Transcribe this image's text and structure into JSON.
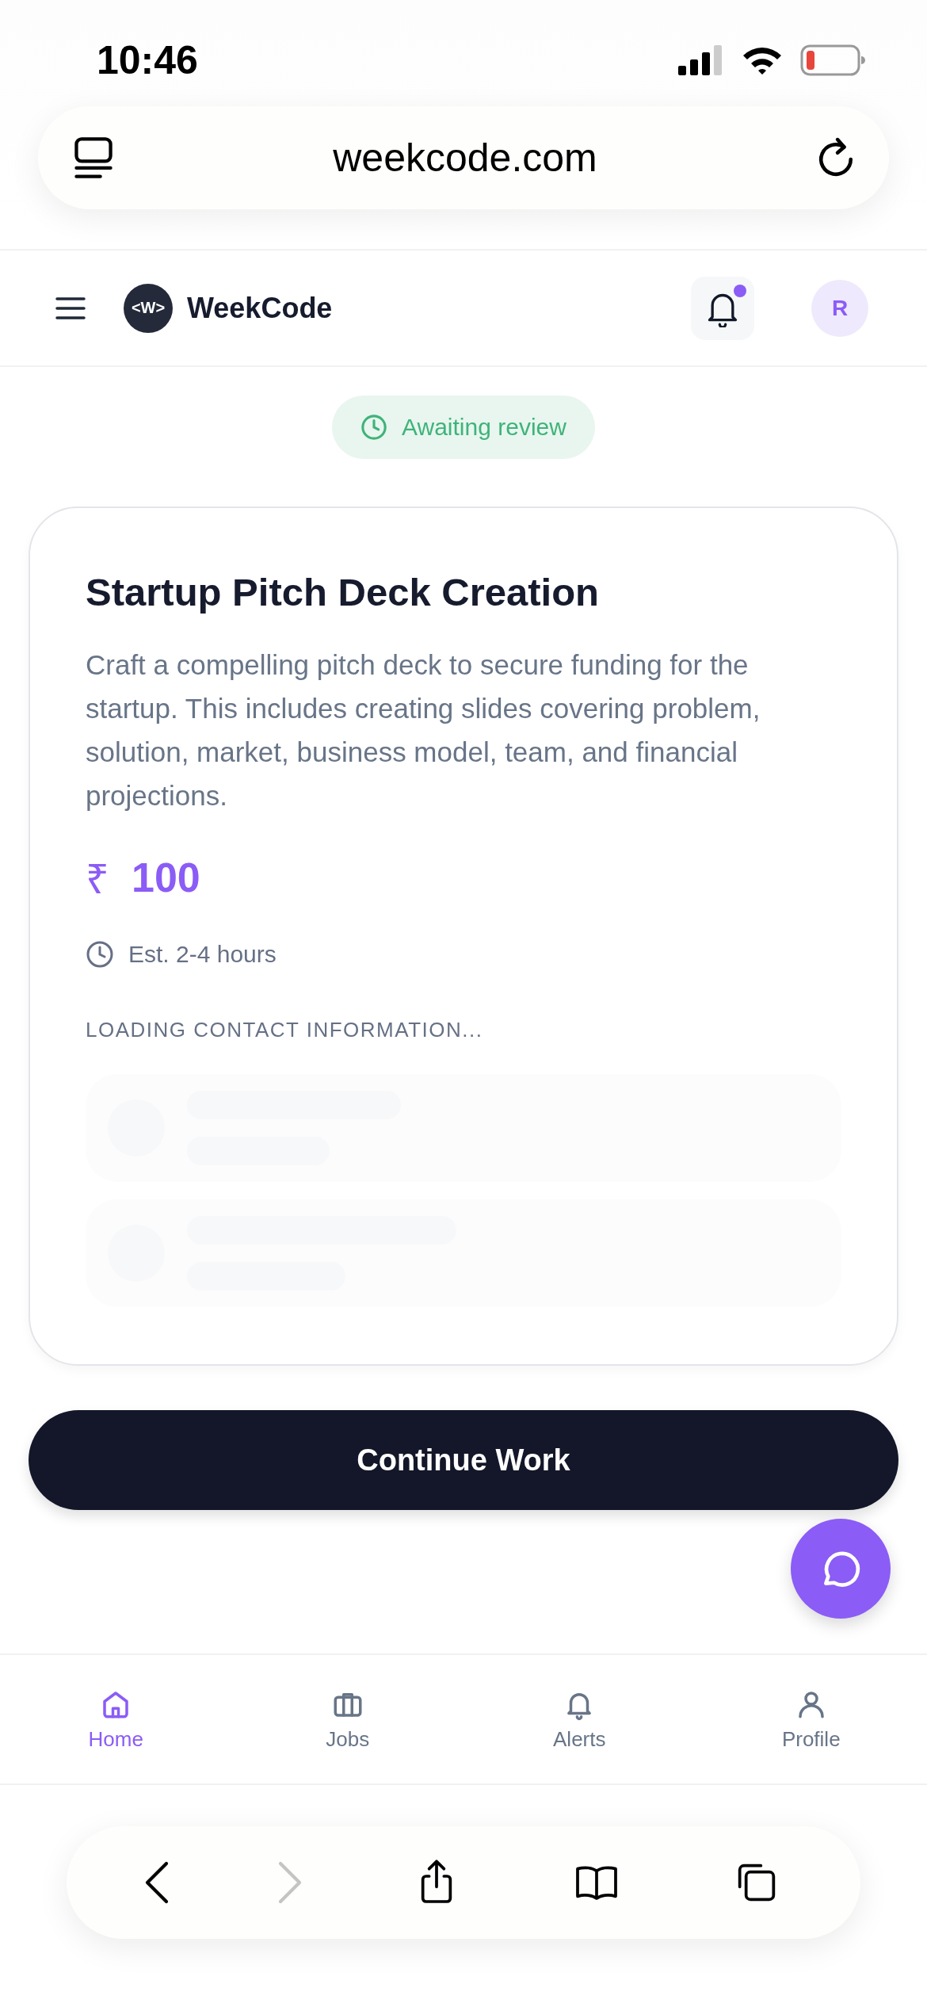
{
  "status_bar": {
    "time": "10:46"
  },
  "browser": {
    "url": "weekcode.com",
    "toolbar": [
      {
        "kind": "back",
        "disabled": false
      },
      {
        "kind": "forward",
        "disabled": true
      },
      {
        "kind": "share",
        "disabled": false
      },
      {
        "kind": "bookmarks",
        "disabled": false
      },
      {
        "kind": "tabs",
        "disabled": false
      }
    ]
  },
  "header": {
    "logo_mark": "<W>",
    "brand": "WeekCode",
    "has_unread": true,
    "avatar": "R"
  },
  "status_badge": "Awaiting review",
  "job": {
    "title": "Startup Pitch Deck Creation",
    "description": "Craft a compelling pitch deck to secure funding for the startup. This includes creating slides covering problem, solution, market, business model, team, and financial projections.",
    "currency": "₹",
    "amount": "100",
    "estimate": "Est. 2-4 hours",
    "contacts_label": "LOADING CONTACT INFORMATION...",
    "contacts": [
      {
        "kind": "placeholder"
      },
      {
        "kind": "placeholder"
      }
    ]
  },
  "primary_button": "Continue Work",
  "bottom_nav": [
    {
      "kind": "home",
      "label": "Home",
      "selected": true
    },
    {
      "kind": "jobs",
      "label": "Jobs",
      "selected": false
    },
    {
      "kind": "alerts",
      "label": "Alerts",
      "selected": false
    },
    {
      "kind": "profile",
      "label": "Profile",
      "selected": false
    }
  ]
}
